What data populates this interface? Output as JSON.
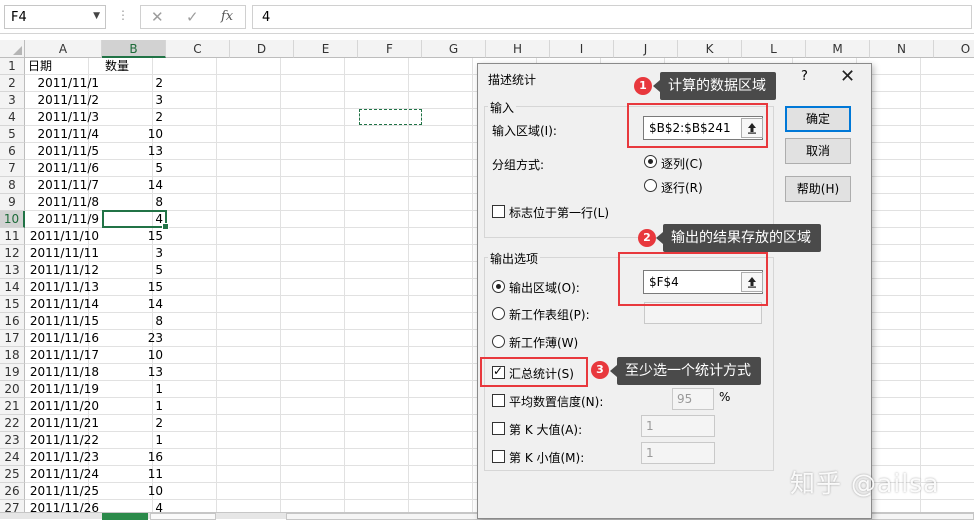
{
  "formula_bar": {
    "name_box": "F4",
    "cancel_icon": "✕",
    "enter_icon": "✓",
    "fx_icon": "fx",
    "value": "4"
  },
  "columns": [
    "A",
    "B",
    "C",
    "D",
    "E",
    "F",
    "G",
    "H",
    "I",
    "J",
    "K",
    "L",
    "M",
    "N",
    "O"
  ],
  "rows": [
    "1",
    "2",
    "3",
    "4",
    "5",
    "6",
    "7",
    "8",
    "9",
    "10",
    "11",
    "12",
    "13",
    "14",
    "15",
    "16",
    "17",
    "18",
    "19",
    "20",
    "21",
    "22",
    "23",
    "24",
    "25",
    "26",
    "27"
  ],
  "table": {
    "header": {
      "date": "日期",
      "count": "数量"
    },
    "data": [
      {
        "date": "2011/11/1",
        "count": "2"
      },
      {
        "date": "2011/11/2",
        "count": "3"
      },
      {
        "date": "2011/11/3",
        "count": "2"
      },
      {
        "date": "2011/11/4",
        "count": "10"
      },
      {
        "date": "2011/11/5",
        "count": "13"
      },
      {
        "date": "2011/11/6",
        "count": "5"
      },
      {
        "date": "2011/11/7",
        "count": "14"
      },
      {
        "date": "2011/11/8",
        "count": "8"
      },
      {
        "date": "2011/11/9",
        "count": "4"
      },
      {
        "date": "2011/11/10",
        "count": "15"
      },
      {
        "date": "2011/11/11",
        "count": "3"
      },
      {
        "date": "2011/11/12",
        "count": "5"
      },
      {
        "date": "2011/11/13",
        "count": "15"
      },
      {
        "date": "2011/11/14",
        "count": "14"
      },
      {
        "date": "2011/11/15",
        "count": "8"
      },
      {
        "date": "2011/11/16",
        "count": "23"
      },
      {
        "date": "2011/11/17",
        "count": "10"
      },
      {
        "date": "2011/11/18",
        "count": "13"
      },
      {
        "date": "2011/11/19",
        "count": "1"
      },
      {
        "date": "2011/11/20",
        "count": "1"
      },
      {
        "date": "2011/11/21",
        "count": "2"
      },
      {
        "date": "2011/11/22",
        "count": "1"
      },
      {
        "date": "2011/11/23",
        "count": "16"
      },
      {
        "date": "2011/11/24",
        "count": "11"
      },
      {
        "date": "2011/11/25",
        "count": "10"
      },
      {
        "date": "2011/11/26",
        "count": "4"
      }
    ]
  },
  "dialog": {
    "title": "描述统计",
    "help_q": "?",
    "close_icon": "✕",
    "input_group": "输入",
    "input_range_label": "输入区域(I):",
    "input_range_value": "$B$2:$B$241",
    "grouping_label": "分组方式:",
    "by_column": "逐列(C)",
    "by_row": "逐行(R)",
    "labels_first_row": "标志位于第一行(L)",
    "output_group": "输出选项",
    "output_range": "输出区域(O):",
    "output_range_value": "$F$4",
    "new_sheet": "新工作表组(P):",
    "new_workbook": "新工作薄(W)",
    "summary_stats": "汇总统计(S)",
    "confidence": "平均数置信度(N):",
    "confidence_value": "95",
    "percent": "%",
    "kth_largest": "第 K 大值(A):",
    "kth_largest_value": "1",
    "kth_smallest": "第 K 小值(M):",
    "kth_smallest_value": "1",
    "ok": "确定",
    "cancel": "取消",
    "help": "帮助(H)"
  },
  "annotations": [
    {
      "num": "1",
      "text": "计算的数据区域"
    },
    {
      "num": "2",
      "text": "输出的结果存放的区域"
    },
    {
      "num": "3",
      "text": "至少选一个统计方式"
    }
  ],
  "watermark": "知乎 @ailsa",
  "colors": {
    "accent_green": "#217346",
    "highlight_red": "#e8383d",
    "callout_bg": "#4a4a4a",
    "default_button_blue": "#0078d7"
  }
}
